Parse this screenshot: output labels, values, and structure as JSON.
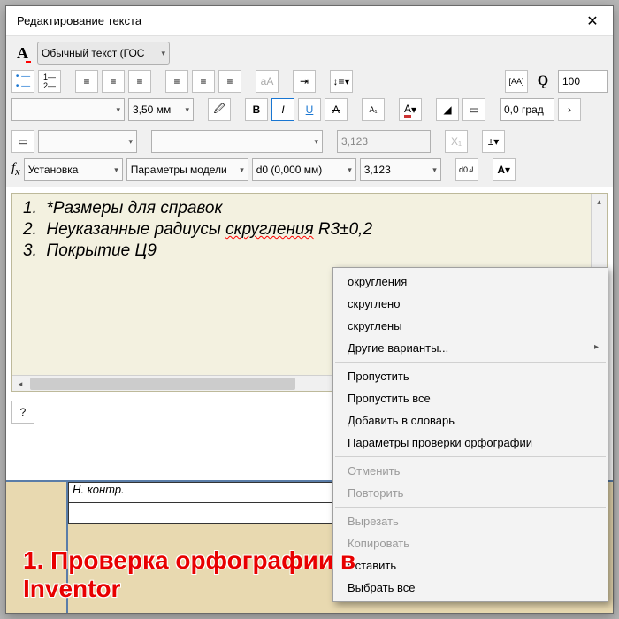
{
  "window": {
    "title": "Редактирование текста"
  },
  "styleRow": {
    "Ai": "A",
    "styleDropdown": "Обычный текст (ГОС"
  },
  "row2": {
    "stackValue": "100"
  },
  "row3": {
    "fontName": "",
    "fontSize": "3,50 мм",
    "angle": "0,0 град"
  },
  "row4": {
    "select1": "",
    "select2": "",
    "numBox": "3,123",
    "pm": "±"
  },
  "row5": {
    "fx": "f",
    "fxSub": "x",
    "sel1": "Установка",
    "sel2": "Параметры модели",
    "sel3": "d0 (0,000 мм)",
    "num": "3,123",
    "A": "A"
  },
  "editor": {
    "lines": [
      {
        "num": "1.",
        "text": "*Размеры для справок"
      },
      {
        "num": "2.",
        "prefix": "Неуказанные радиусы ",
        "err": "скругления",
        "suffix": " R3±0,2"
      },
      {
        "num": "3.",
        "text": "Покрытие Ц9"
      }
    ]
  },
  "contextMenu": {
    "group1": [
      "округления",
      "скруглено",
      "скруглены"
    ],
    "more": "Другие варианты...",
    "group2": [
      "Пропустить",
      "Пропустить все",
      "Добавить в словарь",
      "Параметры проверки орфографии"
    ],
    "group3_disabled": [
      "Отменить",
      "Повторить"
    ],
    "group4": [
      {
        "label": "Вырезать",
        "disabled": true
      },
      {
        "label": "Копировать",
        "disabled": true
      },
      {
        "label": "Вставить",
        "disabled": false
      },
      {
        "label": "Выбрать все",
        "disabled": false
      }
    ]
  },
  "blueprint": {
    "cellLabel": "Н. контр."
  },
  "annotation": {
    "line1": "1. Проверка орфографии в",
    "line2": "Inventor"
  }
}
